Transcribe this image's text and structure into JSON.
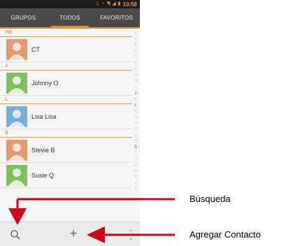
{
  "status_bar": {
    "time": "10:58"
  },
  "tabs": [
    {
      "label": "GRUPOS",
      "active": false
    },
    {
      "label": "TODOS",
      "active": true
    },
    {
      "label": "FAVORITOS",
      "active": false
    }
  ],
  "sections": [
    {
      "header": "YO",
      "contacts": [
        {
          "name": "CT",
          "avatar_color": "#e39a73"
        }
      ]
    },
    {
      "header": "J",
      "contacts": [
        {
          "name": "Johnny O",
          "avatar_color": "#7fbf5d"
        }
      ]
    },
    {
      "header": "L",
      "contacts": [
        {
          "name": "Lisa Lisa",
          "avatar_color": "#79aed6"
        }
      ]
    },
    {
      "header": "S",
      "contacts": [
        {
          "name": "Stevie B",
          "avatar_color": "#e39a73"
        },
        {
          "name": "Susie Q",
          "avatar_color": "#7fbf5d"
        }
      ]
    }
  ],
  "index_letters": [
    "#",
    "A",
    "B",
    "C",
    "D",
    "E",
    "F",
    "G",
    "H",
    "I",
    "J",
    "K",
    "L",
    "M",
    "N",
    "O",
    "P",
    "Q",
    "R",
    "S",
    "T",
    "U",
    "V",
    "W",
    "X",
    "Y",
    "Z"
  ],
  "index_dark_letters": [
    "J",
    "L",
    "S"
  ],
  "bottom_bar": {
    "search_icon": "search-icon",
    "add_icon": "plus-icon",
    "more_icon": "overflow-menu-icon"
  },
  "annotations": {
    "search": "Búsqueda",
    "add": "Agregar Contacto"
  },
  "colors": {
    "accent": "#e8913a",
    "tabs_bg": "#4a4a4a",
    "arrow": "#d0021b"
  }
}
